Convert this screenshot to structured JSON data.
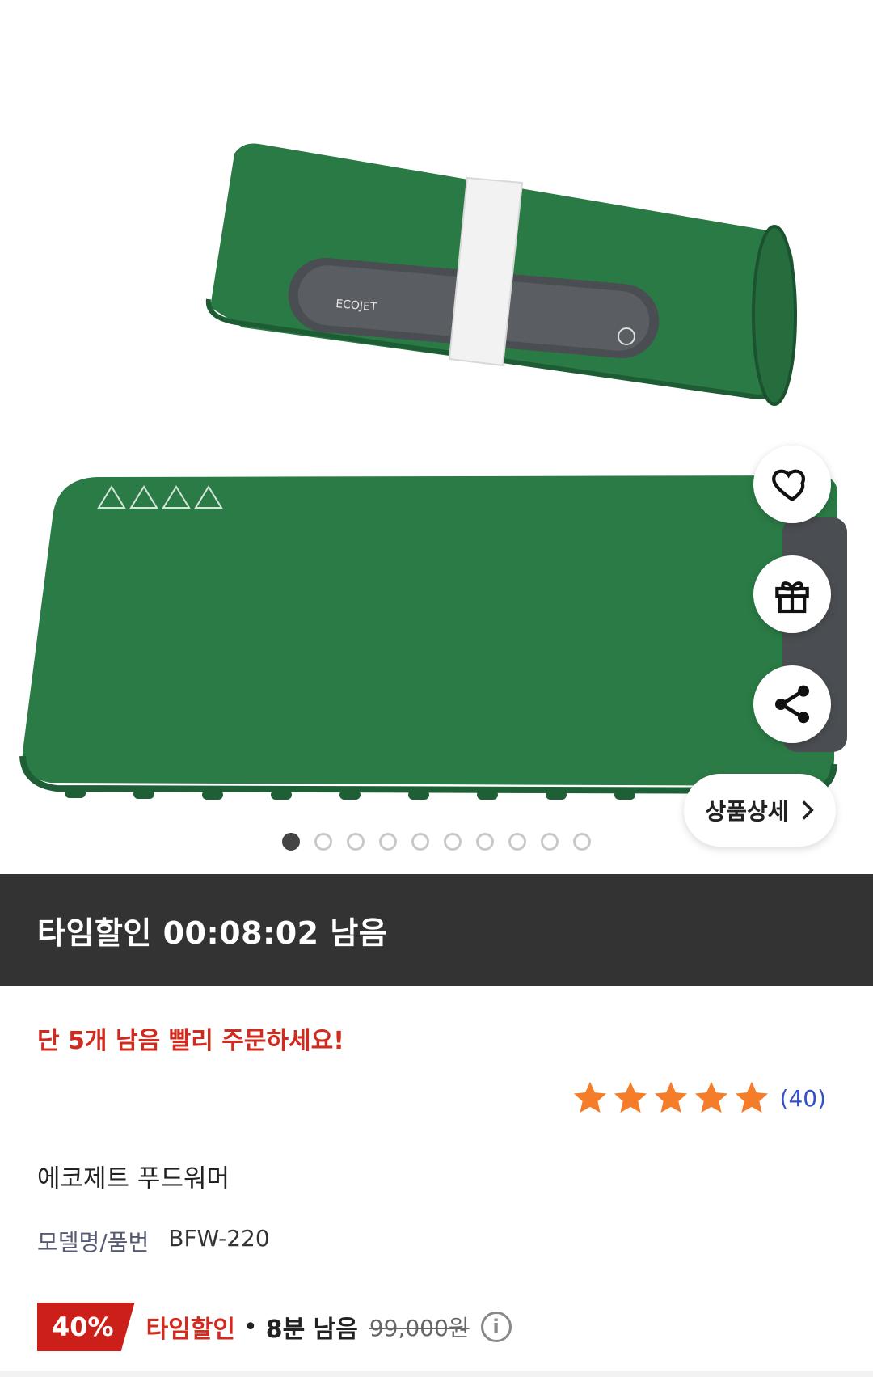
{
  "hero": {
    "image_brand": "ECOJET",
    "carousel": {
      "total": 10,
      "active_index": 0
    },
    "detail_button": "상품상세"
  },
  "timebar": {
    "text": "타임할인 00:08:02 남음"
  },
  "stock_notice": "단 5개 남음 빨리 주문하세요!",
  "rating": {
    "stars": 5,
    "count": "(40)",
    "star_color": "#f57c28"
  },
  "product": {
    "name": "에코제트 푸드워머",
    "model_label": "모델명/품번",
    "model_value": "BFW-220"
  },
  "price": {
    "discount_badge": "40%",
    "time_sale_label": "타임할인",
    "separator": "•",
    "remaining": "8분 남음",
    "original_price": "99,000원"
  },
  "colors": {
    "product_green": "#2a7a45",
    "timebar_bg": "#333333",
    "accent_red": "#d12a1f"
  },
  "icons": [
    "heart-icon",
    "gift-icon",
    "share-icon",
    "chevron-right-icon",
    "info-icon",
    "star-icon"
  ]
}
